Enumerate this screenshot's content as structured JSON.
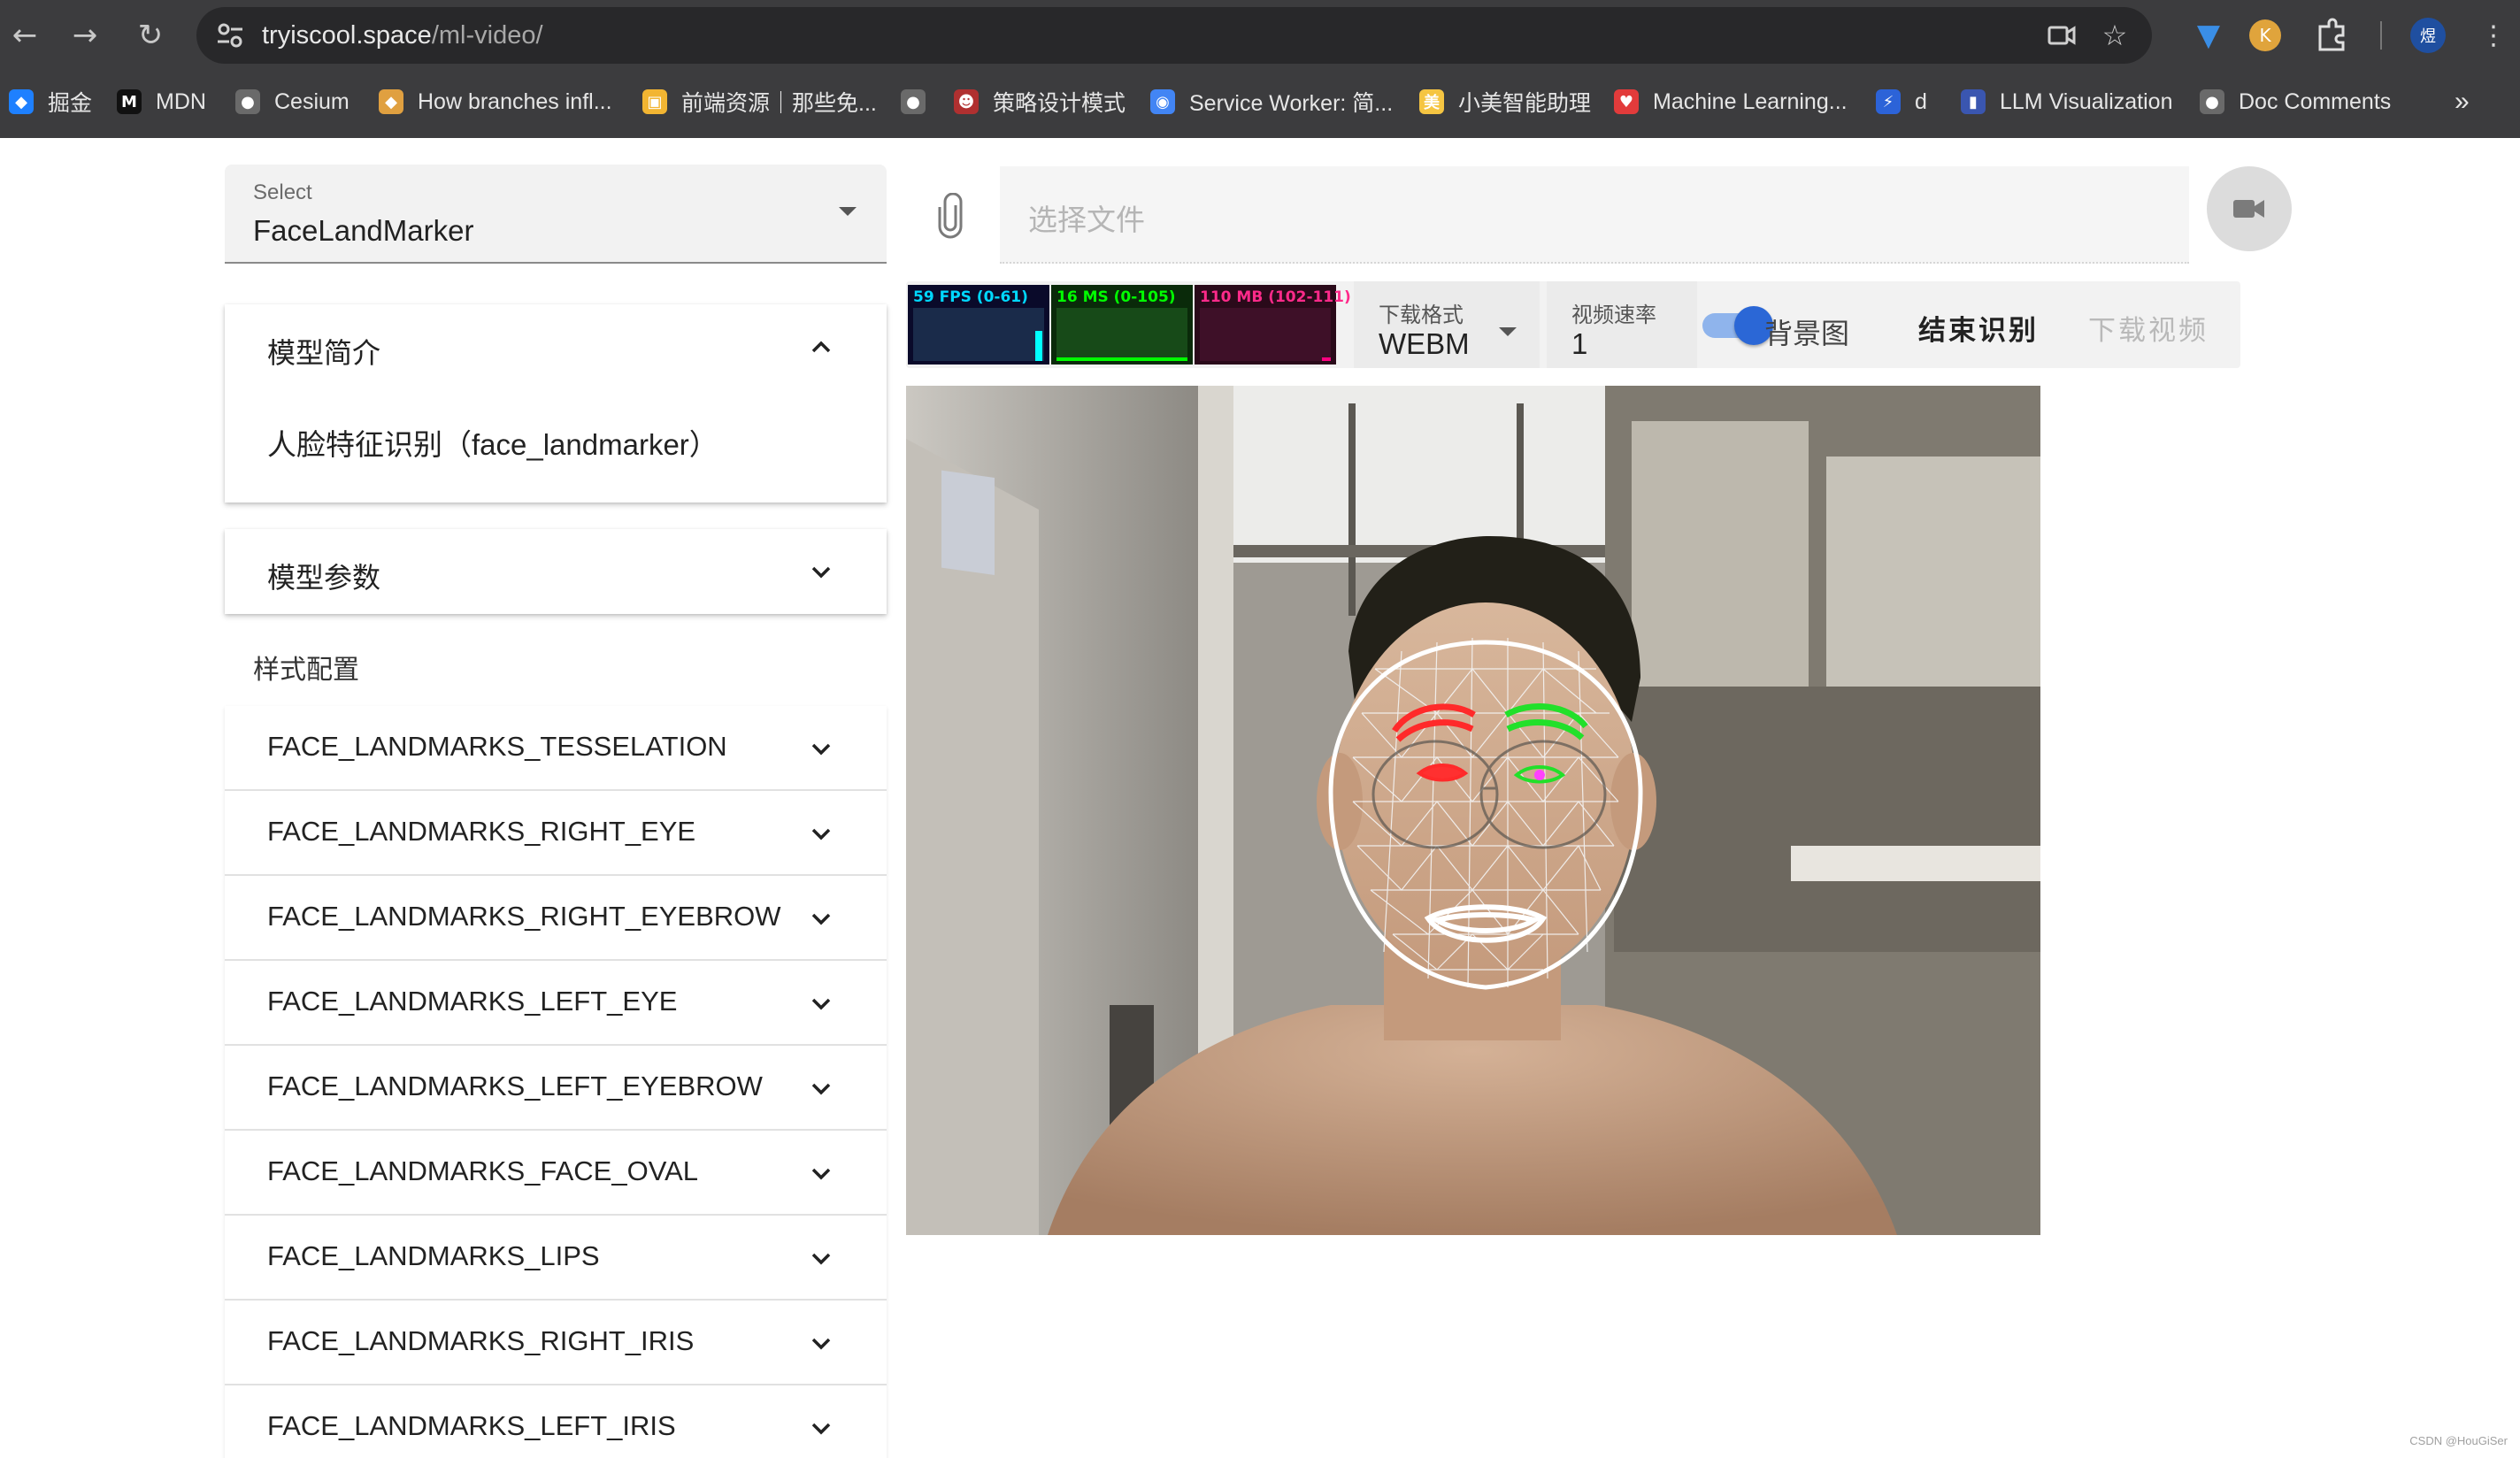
{
  "browser": {
    "url_host": "tryiscool.space",
    "url_path": "/ml-video/",
    "bookmarks": [
      {
        "label": "掘金",
        "icon": "juejin-icon",
        "color": "#1e80ff"
      },
      {
        "label": "MDN",
        "icon": "mdn-icon",
        "color": "#111111"
      },
      {
        "label": "Cesium",
        "icon": "globe-icon",
        "color": "#6a6a6a"
      },
      {
        "label": "How branches infl...",
        "icon": "git-icon",
        "color": "#e0a040"
      },
      {
        "label": "前端资源｜那些免...",
        "icon": "folder-icon",
        "color": "#f2b532"
      },
      {
        "label": "",
        "icon": "globe-icon",
        "color": "#6a6a6a"
      },
      {
        "label": "策略设计模式",
        "icon": "mask-icon",
        "color": "#b03030"
      },
      {
        "label": "Service Worker: 简...",
        "icon": "chrome-icon",
        "color": "#4285f4"
      },
      {
        "label": "小美智能助理",
        "icon": "meituan-icon",
        "color": "#f5c542"
      },
      {
        "label": "Machine Learning...",
        "icon": "heart-icon",
        "color": "#e23b3b"
      },
      {
        "label": "d",
        "icon": "lightning-icon",
        "color": "#2c63d8"
      },
      {
        "label": "LLM Visualization",
        "icon": "llm-icon",
        "color": "#3a56b0"
      },
      {
        "label": "Doc Comments",
        "icon": "globe-icon",
        "color": "#6a6a6a"
      }
    ],
    "profile_initial": "煜",
    "more_bookmarks": "»"
  },
  "sidebar": {
    "select_label": "Select",
    "select_value": "FaceLandMarker",
    "intro_title": "模型简介",
    "intro_body": "人脸特征识别（face_landmarker）",
    "params_title": "模型参数",
    "style_title": "样式配置",
    "landmark_items": [
      "FACE_LANDMARKS_TESSELATION",
      "FACE_LANDMARKS_RIGHT_EYE",
      "FACE_LANDMARKS_RIGHT_EYEBROW",
      "FACE_LANDMARKS_LEFT_EYE",
      "FACE_LANDMARKS_LEFT_EYEBROW",
      "FACE_LANDMARKS_FACE_OVAL",
      "FACE_LANDMARKS_LIPS",
      "FACE_LANDMARKS_RIGHT_IRIS",
      "FACE_LANDMARKS_LEFT_IRIS"
    ]
  },
  "main": {
    "file_placeholder": "选择文件",
    "stats": {
      "fps": "59 FPS (0-61)",
      "ms": "16 MS (0-105)",
      "mb": "110 MB (102-111)",
      "fps_color": "#00ffff",
      "ms_color": "#00ff00",
      "mb_color": "#ff0080"
    },
    "download_format_label": "下载格式",
    "download_format_value": "WEBM",
    "video_rate_label": "视频速率",
    "video_rate_value": "1",
    "background_toggle_label": "背景图",
    "background_toggle_on": true,
    "stop_button": "结束识别",
    "download_button": "下载视频"
  },
  "watermark": "CSDN @HouGiSer"
}
